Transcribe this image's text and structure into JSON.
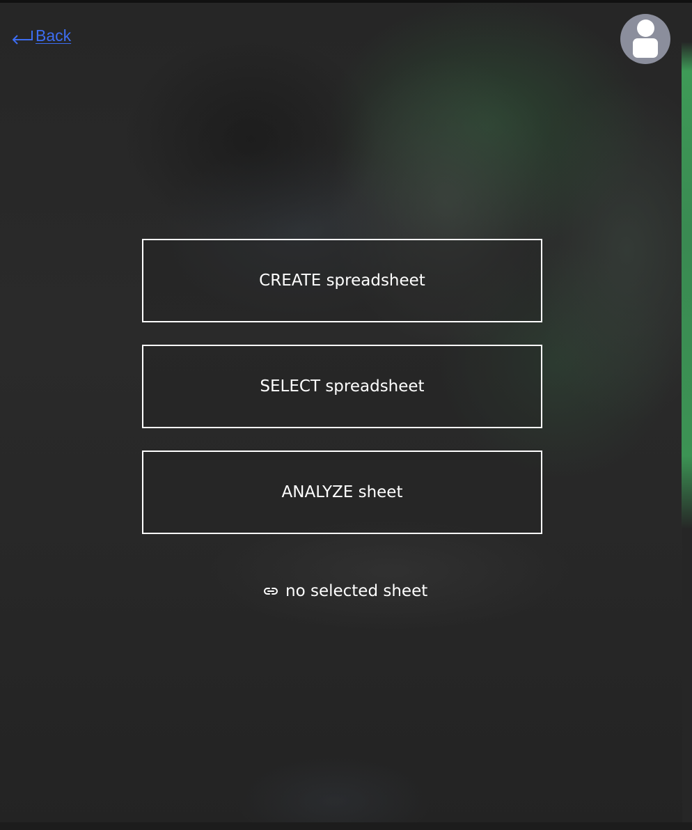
{
  "nav": {
    "back_label": "Back",
    "back_icon": "return-arrow-icon",
    "link_color": "#3d6df2"
  },
  "user": {
    "avatar_icon": "user-avatar-icon",
    "avatar_color": "#8b8e9c"
  },
  "actions": {
    "create_label": "CREATE spreadsheet",
    "select_label": "SELECT spreadsheet",
    "analyze_label": "ANALYZE sheet"
  },
  "status": {
    "icon": "link-icon",
    "text": "no selected sheet"
  },
  "theme": {
    "background": "#232323",
    "accent_green": "#3e9a57",
    "text": "#ffffff"
  }
}
